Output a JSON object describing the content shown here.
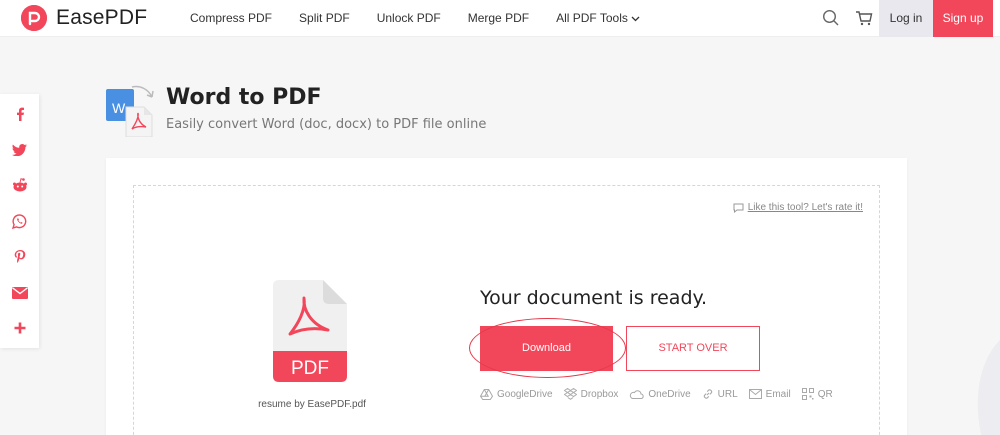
{
  "header": {
    "brand": "EasePDF",
    "nav": [
      {
        "label": "Compress PDF"
      },
      {
        "label": "Split PDF"
      },
      {
        "label": "Unlock PDF"
      },
      {
        "label": "Merge PDF"
      },
      {
        "label": "All PDF Tools"
      }
    ],
    "login_label": "Log in",
    "signup_label": "Sign up"
  },
  "share": [
    "facebook-icon",
    "twitter-icon",
    "reddit-icon",
    "whatsapp-icon",
    "pinterest-icon",
    "email-icon",
    "plus-icon"
  ],
  "page": {
    "title": "Word to PDF",
    "subtitle": "Easily convert Word (doc, docx) to PDF file online"
  },
  "result": {
    "rate_link": "Like this tool? Let's rate it!",
    "file_icon_label": "PDF",
    "file_name": "resume by EasePDF.pdf",
    "message": "Your document is ready.",
    "download_label": "Download",
    "start_over_label": "START OVER",
    "save_options": [
      {
        "label": "GoogleDrive",
        "icon": "google-drive-icon"
      },
      {
        "label": "Dropbox",
        "icon": "dropbox-icon"
      },
      {
        "label": "OneDrive",
        "icon": "onedrive-icon"
      },
      {
        "label": "URL",
        "icon": "link-icon"
      },
      {
        "label": "Email",
        "icon": "email-icon"
      },
      {
        "label": "QR",
        "icon": "qr-icon"
      }
    ]
  },
  "colors": {
    "brand": "#f2475a",
    "annotation": "#e53a4b",
    "word_blue": "#4a90e2"
  }
}
